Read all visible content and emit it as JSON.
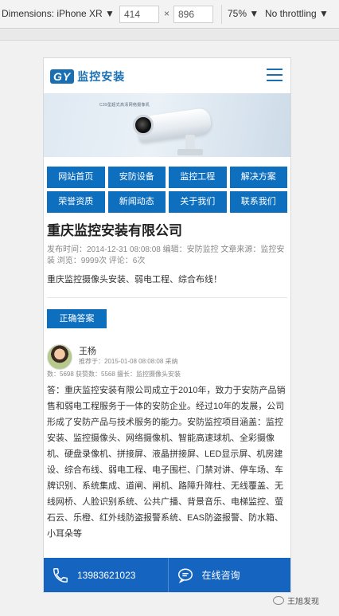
{
  "devtools": {
    "device": "Dimensions: iPhone XR ▼",
    "width": "414",
    "times": "×",
    "height": "896",
    "zoom": "75% ▼",
    "throttle": "No throttling ▼"
  },
  "header": {
    "logo_badge": "GY",
    "logo_text": "监控安装",
    "menu_icon": "hamburger-icon"
  },
  "banner": {
    "caption": "C39型超式高清网络摄像机"
  },
  "nav": {
    "items": [
      {
        "label": "网站首页"
      },
      {
        "label": "安防设备"
      },
      {
        "label": "监控工程"
      },
      {
        "label": "解决方案"
      },
      {
        "label": "荣誉资质"
      },
      {
        "label": "新闻动态"
      },
      {
        "label": "关于我们"
      },
      {
        "label": "联系我们"
      }
    ]
  },
  "article": {
    "title": "重庆监控安装有限公司",
    "meta": "发布时间：2014-12-31 08:08:08  编辑：安防监控  文章来源：监控安装  浏览：9999次  评论：6次",
    "summary": "重庆监控摄像头安装、弱电工程、综合布线！",
    "answer_button": "正确答案"
  },
  "answerer": {
    "name": "王杨",
    "recommend": "推荐于：2015-01-08 08:08:08  采纳",
    "stats": "数：5698  获赞数：5568  擅长：监控摄像头安装"
  },
  "answer_text": "答：重庆监控安装有限公司成立于2010年，致力于安防产品销售和弱电工程服务于一体的安防企业。经过10年的发展，公司形成了安防产品与技术服务的能力。安防监控项目涵盖：监控安装、监控摄像头、网络摄像机、智能高速球机、全彩摄像机、硬盘录像机、拼接屏、液晶拼接屏、LED显示屏、机房建设、综合布线、弱电工程、电子围栏、门禁对讲、停车场、车牌识别、系统集成、道闸、闸机、路障升降柱、无线覆盖、无线网桥、人脸识别系统、公共广播、背景音乐、电梯监控、萤石云、乐橙、红外线防盗报警系统、EAS防盗报警、防水箱、小耳朵等",
  "bottom_bar": {
    "phone": "13983621023",
    "chat": "在线咨询"
  },
  "watermark": "王旭发现"
}
